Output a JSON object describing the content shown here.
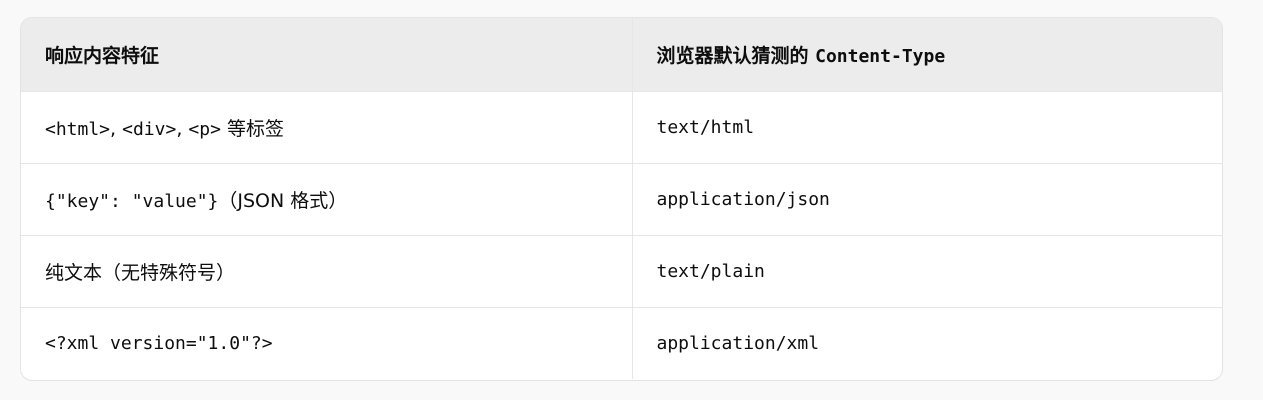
{
  "table": {
    "headers": {
      "col1": "响应内容特征",
      "col2_prefix": "浏览器默认猜测的 ",
      "col2_code": "Content-Type"
    },
    "rows": [
      {
        "feature_code": "<html>",
        "feature_sep1": ", ",
        "feature_code2": "<div>",
        "feature_sep2": ", ",
        "feature_code3": "<p>",
        "feature_text": " 等标签",
        "type": "text/html"
      },
      {
        "feature_code": "{\"key\": \"value\"}",
        "feature_text": "（JSON 格式）",
        "type": "application/json"
      },
      {
        "feature_text": "纯文本（无特殊符号）",
        "type": "text/plain"
      },
      {
        "feature_code": "<?xml version=\"1.0\"?>",
        "type": "application/xml"
      }
    ]
  }
}
